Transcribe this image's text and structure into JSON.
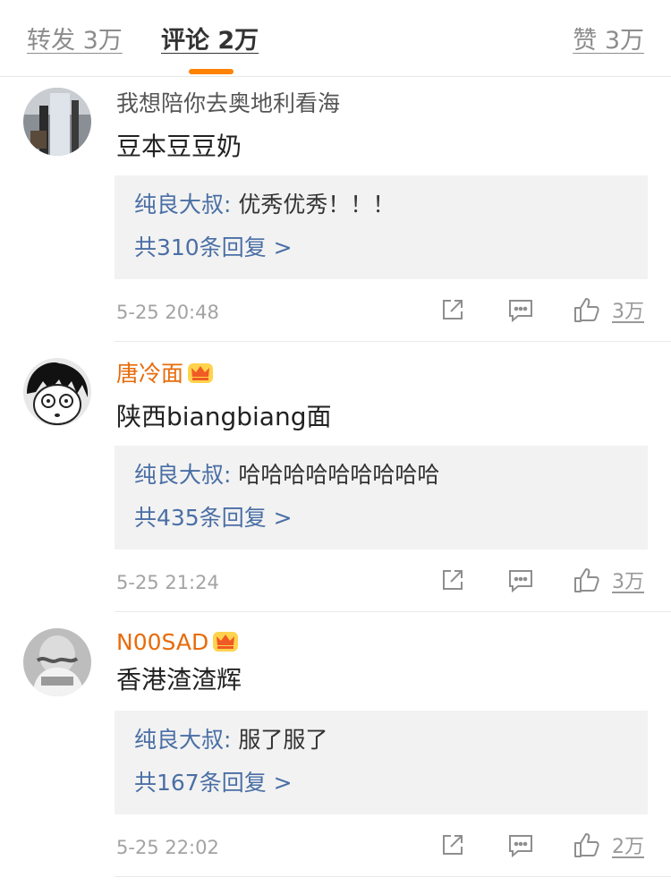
{
  "tabs": {
    "repost": "转发 3万",
    "comments": "评论 2万",
    "likes": "赞 3万"
  },
  "colors": {
    "accent": "#ff8200",
    "vip_name": "#e86b0a",
    "link": "#4a6fa5",
    "reply_bg": "#f2f2f2"
  },
  "comments": [
    {
      "username": "我想陪你去奥地利看海",
      "vip": false,
      "text": "豆本豆豆奶",
      "reply": {
        "author": "纯良大叔:",
        "text": "优秀优秀！！！",
        "count": "共310条回复 >"
      },
      "time": "5-25 20:48",
      "likes": "3万"
    },
    {
      "username": "唐冷面",
      "vip": true,
      "text": "陕西biangbiang面",
      "reply": {
        "author": "纯良大叔:",
        "text": "哈哈哈哈哈哈哈哈哈",
        "count": "共435条回复 >"
      },
      "time": "5-25 21:24",
      "likes": "3万"
    },
    {
      "username": "N00SAD",
      "vip": true,
      "text": "香港渣渣辉",
      "reply": {
        "author": "纯良大叔:",
        "text": "服了服了",
        "count": "共167条回复 >"
      },
      "time": "5-25 22:02",
      "likes": "2万"
    }
  ],
  "icons": {
    "share": "share-icon",
    "comment": "comment-icon",
    "like": "thumbs-up-icon",
    "badge": "crown-icon"
  }
}
